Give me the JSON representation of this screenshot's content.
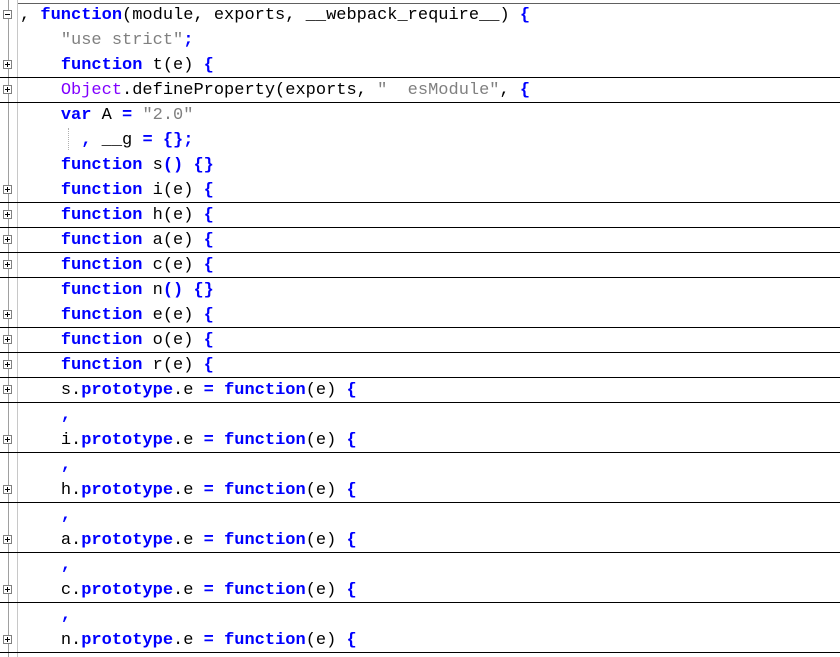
{
  "editor": {
    "lines": [
      {
        "fold": "minus",
        "folded": false,
        "tokens": [
          {
            "t": ", ",
            "c": "plain"
          },
          {
            "t": "function",
            "c": "kw"
          },
          {
            "t": "(module, exports, __webpack_require__) ",
            "c": "plain"
          },
          {
            "t": "{",
            "c": "kw"
          }
        ]
      },
      {
        "fold": "",
        "folded": false,
        "tokens": [
          {
            "t": "    ",
            "c": "plain"
          },
          {
            "t": "\"use strict\"",
            "c": "str"
          },
          {
            "t": ";",
            "c": "kw"
          }
        ]
      },
      {
        "fold": "plus",
        "folded": true,
        "tokens": [
          {
            "t": "    ",
            "c": "plain"
          },
          {
            "t": "function",
            "c": "kw"
          },
          {
            "t": " t(e) ",
            "c": "plain"
          },
          {
            "t": "{",
            "c": "kw"
          }
        ]
      },
      {
        "fold": "plus",
        "folded": true,
        "tokens": [
          {
            "t": "    ",
            "c": "plain"
          },
          {
            "t": "Object",
            "c": "obj"
          },
          {
            "t": ".defineProperty(exports, ",
            "c": "plain"
          },
          {
            "t": "\"  esModule\"",
            "c": "str"
          },
          {
            "t": ", ",
            "c": "plain"
          },
          {
            "t": "{",
            "c": "kw"
          }
        ]
      },
      {
        "fold": "",
        "folded": false,
        "tokens": [
          {
            "t": "    ",
            "c": "plain"
          },
          {
            "t": "var",
            "c": "kw"
          },
          {
            "t": " A ",
            "c": "plain"
          },
          {
            "t": "=",
            "c": "kw"
          },
          {
            "t": " ",
            "c": "plain"
          },
          {
            "t": "\"2.0\"",
            "c": "str"
          }
        ]
      },
      {
        "fold": "",
        "folded": false,
        "tokens": [
          {
            "t": "      ",
            "c": "plain"
          },
          {
            "t": ",",
            "c": "kw"
          },
          {
            "t": " __g ",
            "c": "plain"
          },
          {
            "t": "=",
            "c": "kw"
          },
          {
            "t": " ",
            "c": "plain"
          },
          {
            "t": "{};",
            "c": "kw"
          }
        ]
      },
      {
        "fold": "",
        "folded": false,
        "tokens": [
          {
            "t": "    ",
            "c": "plain"
          },
          {
            "t": "function",
            "c": "kw"
          },
          {
            "t": " s",
            "c": "plain"
          },
          {
            "t": "()",
            "c": "kw"
          },
          {
            "t": " ",
            "c": "plain"
          },
          {
            "t": "{}",
            "c": "kw"
          }
        ]
      },
      {
        "fold": "plus",
        "folded": true,
        "tokens": [
          {
            "t": "    ",
            "c": "plain"
          },
          {
            "t": "function",
            "c": "kw"
          },
          {
            "t": " i(e) ",
            "c": "plain"
          },
          {
            "t": "{",
            "c": "kw"
          }
        ]
      },
      {
        "fold": "plus",
        "folded": true,
        "tokens": [
          {
            "t": "    ",
            "c": "plain"
          },
          {
            "t": "function",
            "c": "kw"
          },
          {
            "t": " h(e) ",
            "c": "plain"
          },
          {
            "t": "{",
            "c": "kw"
          }
        ]
      },
      {
        "fold": "plus",
        "folded": true,
        "tokens": [
          {
            "t": "    ",
            "c": "plain"
          },
          {
            "t": "function",
            "c": "kw"
          },
          {
            "t": " a(e) ",
            "c": "plain"
          },
          {
            "t": "{",
            "c": "kw"
          }
        ]
      },
      {
        "fold": "plus",
        "folded": true,
        "tokens": [
          {
            "t": "    ",
            "c": "plain"
          },
          {
            "t": "function",
            "c": "kw"
          },
          {
            "t": " c(e) ",
            "c": "plain"
          },
          {
            "t": "{",
            "c": "kw"
          }
        ]
      },
      {
        "fold": "",
        "folded": false,
        "tokens": [
          {
            "t": "    ",
            "c": "plain"
          },
          {
            "t": "function",
            "c": "kw"
          },
          {
            "t": " n",
            "c": "plain"
          },
          {
            "t": "()",
            "c": "kw"
          },
          {
            "t": " ",
            "c": "plain"
          },
          {
            "t": "{}",
            "c": "kw"
          }
        ]
      },
      {
        "fold": "plus",
        "folded": true,
        "tokens": [
          {
            "t": "    ",
            "c": "plain"
          },
          {
            "t": "function",
            "c": "kw"
          },
          {
            "t": " e(e) ",
            "c": "plain"
          },
          {
            "t": "{",
            "c": "kw"
          }
        ]
      },
      {
        "fold": "plus",
        "folded": true,
        "tokens": [
          {
            "t": "    ",
            "c": "plain"
          },
          {
            "t": "function",
            "c": "kw"
          },
          {
            "t": " o(e) ",
            "c": "plain"
          },
          {
            "t": "{",
            "c": "kw"
          }
        ]
      },
      {
        "fold": "plus",
        "folded": true,
        "tokens": [
          {
            "t": "    ",
            "c": "plain"
          },
          {
            "t": "function",
            "c": "kw"
          },
          {
            "t": " r(e) ",
            "c": "plain"
          },
          {
            "t": "{",
            "c": "kw"
          }
        ]
      },
      {
        "fold": "plus",
        "folded": true,
        "tokens": [
          {
            "t": "    ",
            "c": "plain"
          },
          {
            "t": "s.",
            "c": "plain"
          },
          {
            "t": "prototype",
            "c": "kw"
          },
          {
            "t": ".e ",
            "c": "plain"
          },
          {
            "t": "=",
            "c": "kw"
          },
          {
            "t": " ",
            "c": "plain"
          },
          {
            "t": "function",
            "c": "kw"
          },
          {
            "t": "(e) ",
            "c": "plain"
          },
          {
            "t": "{",
            "c": "kw"
          }
        ]
      },
      {
        "fold": "",
        "folded": false,
        "tokens": [
          {
            "t": "    ",
            "c": "plain"
          },
          {
            "t": ",",
            "c": "kw"
          }
        ]
      },
      {
        "fold": "plus",
        "folded": true,
        "tokens": [
          {
            "t": "    ",
            "c": "plain"
          },
          {
            "t": "i.",
            "c": "plain"
          },
          {
            "t": "prototype",
            "c": "kw"
          },
          {
            "t": ".e ",
            "c": "plain"
          },
          {
            "t": "=",
            "c": "kw"
          },
          {
            "t": " ",
            "c": "plain"
          },
          {
            "t": "function",
            "c": "kw"
          },
          {
            "t": "(e) ",
            "c": "plain"
          },
          {
            "t": "{",
            "c": "kw"
          }
        ]
      },
      {
        "fold": "",
        "folded": false,
        "tokens": [
          {
            "t": "    ",
            "c": "plain"
          },
          {
            "t": ",",
            "c": "kw"
          }
        ]
      },
      {
        "fold": "plus",
        "folded": true,
        "tokens": [
          {
            "t": "    ",
            "c": "plain"
          },
          {
            "t": "h.",
            "c": "plain"
          },
          {
            "t": "prototype",
            "c": "kw"
          },
          {
            "t": ".e ",
            "c": "plain"
          },
          {
            "t": "=",
            "c": "kw"
          },
          {
            "t": " ",
            "c": "plain"
          },
          {
            "t": "function",
            "c": "kw"
          },
          {
            "t": "(e) ",
            "c": "plain"
          },
          {
            "t": "{",
            "c": "kw"
          }
        ]
      },
      {
        "fold": "",
        "folded": false,
        "tokens": [
          {
            "t": "    ",
            "c": "plain"
          },
          {
            "t": ",",
            "c": "kw"
          }
        ]
      },
      {
        "fold": "plus",
        "folded": true,
        "tokens": [
          {
            "t": "    ",
            "c": "plain"
          },
          {
            "t": "a.",
            "c": "plain"
          },
          {
            "t": "prototype",
            "c": "kw"
          },
          {
            "t": ".e ",
            "c": "plain"
          },
          {
            "t": "=",
            "c": "kw"
          },
          {
            "t": " ",
            "c": "plain"
          },
          {
            "t": "function",
            "c": "kw"
          },
          {
            "t": "(e) ",
            "c": "plain"
          },
          {
            "t": "{",
            "c": "kw"
          }
        ]
      },
      {
        "fold": "",
        "folded": false,
        "tokens": [
          {
            "t": "    ",
            "c": "plain"
          },
          {
            "t": ",",
            "c": "kw"
          }
        ]
      },
      {
        "fold": "plus",
        "folded": true,
        "tokens": [
          {
            "t": "    ",
            "c": "plain"
          },
          {
            "t": "c.",
            "c": "plain"
          },
          {
            "t": "prototype",
            "c": "kw"
          },
          {
            "t": ".e ",
            "c": "plain"
          },
          {
            "t": "=",
            "c": "kw"
          },
          {
            "t": " ",
            "c": "plain"
          },
          {
            "t": "function",
            "c": "kw"
          },
          {
            "t": "(e) ",
            "c": "plain"
          },
          {
            "t": "{",
            "c": "kw"
          }
        ]
      },
      {
        "fold": "",
        "folded": false,
        "tokens": [
          {
            "t": "    ",
            "c": "plain"
          },
          {
            "t": ",",
            "c": "kw"
          }
        ]
      },
      {
        "fold": "plus",
        "folded": true,
        "tokens": [
          {
            "t": "    ",
            "c": "plain"
          },
          {
            "t": "n.",
            "c": "plain"
          },
          {
            "t": "prototype",
            "c": "kw"
          },
          {
            "t": ".e ",
            "c": "plain"
          },
          {
            "t": "=",
            "c": "kw"
          },
          {
            "t": " ",
            "c": "plain"
          },
          {
            "t": "function",
            "c": "kw"
          },
          {
            "t": "(e) ",
            "c": "plain"
          },
          {
            "t": "{",
            "c": "kw"
          }
        ]
      }
    ]
  },
  "colors": {
    "keyword": "#0000ff",
    "string": "#808080",
    "builtin_object": "#8000ff",
    "text": "#000000",
    "background": "#ffffff"
  },
  "icons": {
    "fold_expanded": "fold-minus-icon",
    "fold_collapsed": "fold-plus-icon"
  }
}
